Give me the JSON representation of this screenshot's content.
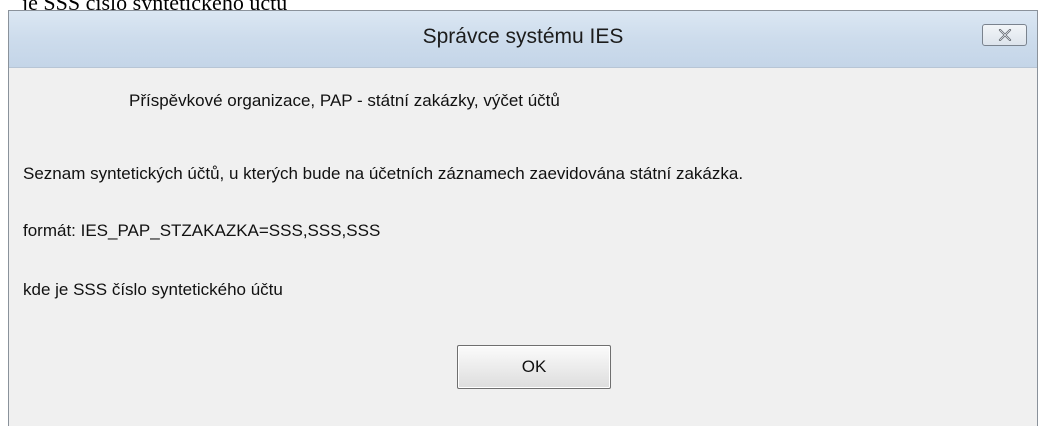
{
  "background": {
    "partial_text": "je SSS číslo syntetického účtu"
  },
  "dialog": {
    "title": "Správce systému IES",
    "close_icon": "close-icon",
    "heading": "Příspěvkové organizace, PAP - státní zakázky, výčet účtů",
    "description": "Seznam syntetických účtů, u kterých bude na účetních záznamech zaevidována státní zakázka.",
    "format_line": "formát: IES_PAP_STZAKAZKA=SSS,SSS,SSS",
    "where_line": "kde je SSS číslo syntetického účtu",
    "ok_label": "OK"
  },
  "colors": {
    "title_bar": "#cddcec",
    "content_bg": "#f0f0f0",
    "border": "#8a929b"
  }
}
